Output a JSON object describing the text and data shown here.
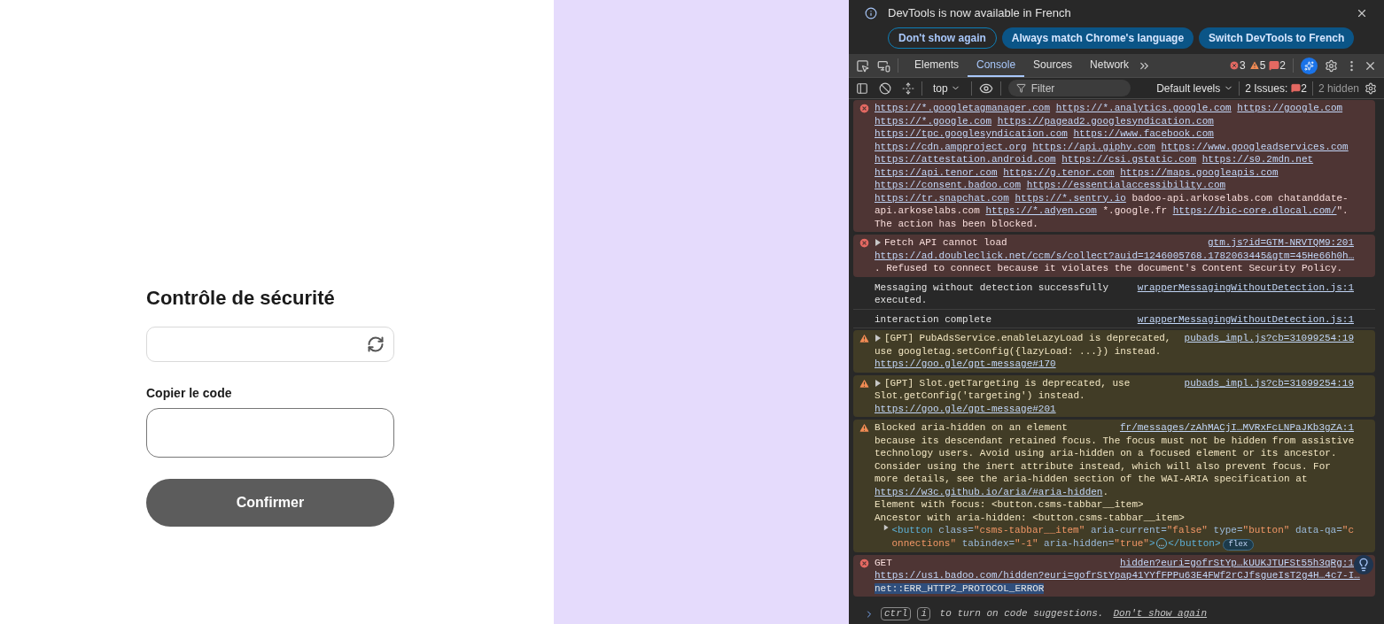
{
  "page": {
    "title": "Contrôle de sécurité",
    "code_label": "Copier le code",
    "confirm_button": "Confirmer"
  },
  "devtools": {
    "notice": {
      "text": "DevTools is now available in French",
      "buttons": [
        {
          "label": "Don't show again",
          "kind": "outline"
        },
        {
          "label": "Always match Chrome's language",
          "kind": "filled"
        },
        {
          "label": "Switch DevTools to French",
          "kind": "filled"
        }
      ]
    },
    "tabs": [
      {
        "label": "Elements",
        "selected": false
      },
      {
        "label": "Console",
        "selected": true
      },
      {
        "label": "Sources",
        "selected": false
      },
      {
        "label": "Network",
        "selected": false
      }
    ],
    "counts": {
      "errors": "3",
      "warnings": "5",
      "issues": "2"
    },
    "toolbar": {
      "context": "top",
      "filter_placeholder": "Filter",
      "levels": "Default levels",
      "issues_label": "2 Issues:",
      "issues_count": "2",
      "hidden": "2 hidden"
    },
    "messages": [
      {
        "kind": "error",
        "expander": false,
        "lines": [
          [
            {
              "kind": "link",
              "text": "https://*.googletagmanager.com"
            },
            {
              "kind": "space"
            },
            {
              "kind": "link",
              "text": "https://*.analytics.google.com"
            },
            {
              "kind": "space"
            },
            {
              "kind": "link",
              "text": "https://google.com"
            }
          ],
          [
            {
              "kind": "link",
              "text": "https://*.google.com"
            },
            {
              "kind": "space"
            },
            {
              "kind": "link",
              "text": "https://pagead2.googlesyndication.com"
            }
          ],
          [
            {
              "kind": "link",
              "text": "https://tpc.googlesyndication.com"
            },
            {
              "kind": "space"
            },
            {
              "kind": "link",
              "text": "https://www.facebook.com"
            }
          ],
          [
            {
              "kind": "link",
              "text": "https://cdn.ampproject.org"
            },
            {
              "kind": "space"
            },
            {
              "kind": "link",
              "text": "https://api.giphy.com"
            },
            {
              "kind": "space"
            },
            {
              "kind": "link",
              "text": "https://www.googleadservices.com"
            }
          ],
          [
            {
              "kind": "link",
              "text": "https://attestation.android.com"
            },
            {
              "kind": "space"
            },
            {
              "kind": "link",
              "text": "https://csi.gstatic.com"
            },
            {
              "kind": "space"
            },
            {
              "kind": "link",
              "text": "https://s0.2mdn.net"
            }
          ],
          [
            {
              "kind": "link",
              "text": "https://api.tenor.com"
            },
            {
              "kind": "space"
            },
            {
              "kind": "link",
              "text": "https://g.tenor.com"
            },
            {
              "kind": "space"
            },
            {
              "kind": "link",
              "text": "https://maps.googleapis.com"
            }
          ],
          [
            {
              "kind": "link",
              "text": "https://consent.badoo.com"
            },
            {
              "kind": "space"
            },
            {
              "kind": "link",
              "text": "https://essentialaccessibility.com"
            }
          ],
          [
            {
              "kind": "link",
              "text": "https://tr.snapchat.com"
            },
            {
              "kind": "space"
            },
            {
              "kind": "link",
              "text": "https://*.sentry.io"
            },
            {
              "kind": "text",
              "text": " badoo-api.arkoselabs.com chatanddate-"
            }
          ],
          [
            {
              "kind": "text",
              "text": "api.arkoselabs.com "
            },
            {
              "kind": "link",
              "text": "https://*.adyen.com"
            },
            {
              "kind": "text",
              "text": " *.google.fr "
            },
            {
              "kind": "link",
              "text": "https://bic-core.dlocal.com/"
            },
            {
              "kind": "text",
              "text": "\"."
            }
          ],
          [
            {
              "kind": "text",
              "text": "The action has been blocked."
            }
          ]
        ]
      },
      {
        "kind": "error",
        "expander": true,
        "source": "gtm.js?id=GTM-NRVTQM9:201",
        "lines": [
          [
            {
              "kind": "text",
              "text": "Fetch API cannot load"
            }
          ],
          [
            {
              "kind": "link",
              "text": "https://ad.doubleclick.net/ccm/s/collect?auid=1246005768.1782063445&gtm=45He66h0h…"
            }
          ],
          [
            {
              "kind": "text",
              "text": ". Refused to connect because it violates the document's Content Security Policy."
            }
          ]
        ]
      },
      {
        "kind": "info",
        "expander": false,
        "source": "wrapperMessagingWithoutDetection.js:1",
        "lines": [
          [
            {
              "kind": "text",
              "text": "Messaging without detection successfully"
            }
          ],
          [
            {
              "kind": "text",
              "text": "executed."
            }
          ]
        ]
      },
      {
        "kind": "info",
        "expander": false,
        "source": "wrapperMessagingWithoutDetection.js:1",
        "lines": [
          [
            {
              "kind": "text",
              "text": "interaction complete"
            }
          ]
        ]
      },
      {
        "kind": "warning",
        "expander": true,
        "source": "pubads_impl.js?cb=31099254:19",
        "lines": [
          [
            {
              "kind": "text",
              "text": "[GPT] PubAdsService.enableLazyLoad is deprecated,"
            }
          ],
          [
            {
              "kind": "text",
              "text": "use googletag.setConfig({lazyLoad: ...}) instead."
            }
          ],
          [
            {
              "kind": "link",
              "text": "https://goo.gle/gpt-message#170"
            }
          ]
        ]
      },
      {
        "kind": "warning",
        "expander": true,
        "source": "pubads_impl.js?cb=31099254:19",
        "lines": [
          [
            {
              "kind": "text",
              "text": "[GPT] Slot.getTargeting is deprecated, use"
            }
          ],
          [
            {
              "kind": "text",
              "text": "Slot.getConfig('targeting') instead."
            }
          ],
          [
            {
              "kind": "link",
              "text": "https://goo.gle/gpt-message#201"
            }
          ]
        ]
      },
      {
        "kind": "warning",
        "expander": false,
        "source": "fr/messages/zAhMACjI…MVRxFcLNPaJKb3gZA:1",
        "lines": [
          [
            {
              "kind": "text",
              "text": "Blocked aria-hidden on an element"
            }
          ],
          [
            {
              "kind": "text",
              "text": "because its descendant retained focus. The focus must not be hidden from assistive"
            }
          ],
          [
            {
              "kind": "text",
              "text": "technology users. Avoid using aria-hidden on a focused element or its ancestor."
            }
          ],
          [
            {
              "kind": "text",
              "text": "Consider using the inert attribute instead, which will also prevent focus. For"
            }
          ],
          [
            {
              "kind": "text",
              "text": "more details, see the aria-hidden section of the WAI-ARIA specification at"
            }
          ],
          [
            {
              "kind": "link",
              "text": "https://w3c.github.io/aria/#aria-hidden"
            },
            {
              "kind": "text",
              "text": "."
            }
          ],
          [
            {
              "kind": "text",
              "text": "Element with focus: <button.csms-tabbar__item>"
            }
          ],
          [
            {
              "kind": "text",
              "text": "Ancestor with aria-hidden: <button.csms-tabbar__item>"
            }
          ]
        ],
        "node": {
          "expanded": false,
          "badge": "flex",
          "lines": [
            [
              {
                "kind": "tag",
                "text": "<button"
              },
              {
                "kind": "attr",
                "text": " class="
              },
              {
                "kind": "value",
                "text": "\"csms-tabbar__item\""
              },
              {
                "kind": "attr",
                "text": " aria-current="
              },
              {
                "kind": "value",
                "text": "\"false\""
              },
              {
                "kind": "attr",
                "text": " type="
              },
              {
                "kind": "value",
                "text": "\"button\""
              },
              {
                "kind": "attr",
                "text": " data-qa="
              },
              {
                "kind": "value",
                "text": "\"c"
              }
            ],
            [
              {
                "kind": "value",
                "text": "onnections\""
              },
              {
                "kind": "attr",
                "text": " tabindex="
              },
              {
                "kind": "value",
                "text": "\"-1\""
              },
              {
                "kind": "attr",
                "text": " aria-hidden="
              },
              {
                "kind": "value",
                "text": "\"true\""
              },
              {
                "kind": "tag",
                "text": ">"
              },
              {
                "kind": "ellipsis",
                "text": "…"
              },
              {
                "kind": "tag",
                "text": "</button>"
              }
            ]
          ]
        }
      },
      {
        "kind": "error",
        "expander": false,
        "source": "hidden?euri=gofrStYp…kUUKJTUFSt55h3qRg:1",
        "lines": [
          [
            {
              "kind": "text",
              "text": "GET"
            }
          ],
          [
            {
              "kind": "link",
              "text": "https://us1.badoo.com/hidden?euri=gofrStYpap41YYfFPPu63E4FWf2rCJfsgueIsT2g4H…4c7-I…"
            }
          ],
          [
            {
              "kind": "selected",
              "text": "net::ERR_HTTP2_PROTOCOL_ERROR"
            }
          ]
        ]
      }
    ],
    "prompt": {
      "keys": [
        "ctrl",
        "i"
      ],
      "hint": " to turn on code suggestions.",
      "link": "Don't show again"
    }
  }
}
